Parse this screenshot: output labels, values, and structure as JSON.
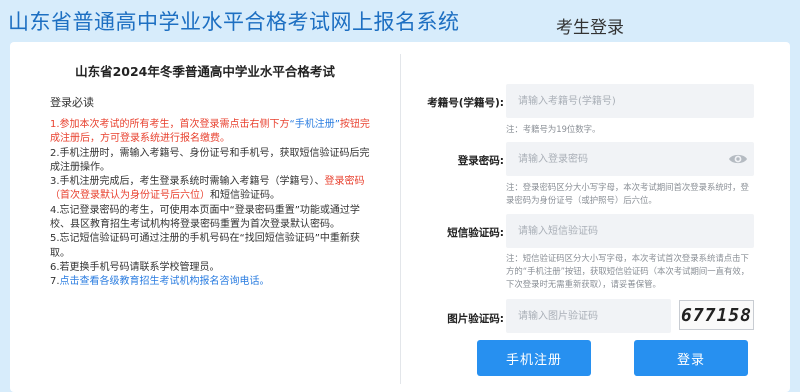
{
  "site_title": "山东省普通高中学业水平合格考试网上报名系统",
  "left": {
    "exam_title": "山东省2024年冬季普通高中学业水平合格考试",
    "notice_heading": "登录必读",
    "item1_red_a": "1.参加本次考试的所有考生，首次登录需点击右侧下方",
    "item1_blue": "“手机注册”",
    "item1_red_b": "按钮完成注册后，方可登录系统进行报名缴费。",
    "item2": "2.手机注册时，需输入考籍号、身份证号和手机号，获取短信验证码后完成注册操作。",
    "item3_a": "3.手机注册完成后，考生登录系统时需输入考籍号（学籍号）、",
    "item3_red": "登录密码（首次登录默认为身份证号后六位）",
    "item3_b": "和短信验证码。",
    "item4": "4.忘记登录密码的考生，可使用本页面中“登录密码重置”功能或通过学校、县区教育招生考试机构将登录密码重置为首次登录默认密码。",
    "item5": "5.忘记短信验证码可通过注册的手机号码在“找回短信验证码”中重新获取。",
    "item6": "6.若更换手机号码请联系学校管理员。",
    "item7_prefix": "7.",
    "item7_blue": "点击查看各级教育招生考试机构报名咨询电话。"
  },
  "login": {
    "title": "考生登录",
    "exam_no_label": "考籍号(学籍号):",
    "exam_no_placeholder": "请输入考籍号(学籍号)",
    "exam_no_note": "注：考籍号为19位数字。",
    "password_label": "登录密码:",
    "password_placeholder": "请输入登录密码",
    "password_note": "注：登录密码区分大小写字母，本次考试期间首次登录系统时，登录密码为身份证号（或护照号）后六位。",
    "sms_label": "短信验证码:",
    "sms_placeholder": "请输入短信验证码",
    "sms_note": "注：短信验证码区分大小写字母，本次考试首次登录系统请点击下方的“手机注册”按钮，获取短信验证码（本次考试期间一直有效，下次登录时无需重新获取），请妥善保管。",
    "captcha_label": "图片验证码:",
    "captcha_placeholder": "请输入图片验证码",
    "captcha_text": "677158",
    "register_button": "手机注册",
    "login_button": "登录"
  },
  "colors": {
    "accent": "#2790f0",
    "title": "#1d6fc2",
    "warning": "#e8412f",
    "link": "#2b7de0",
    "background": "#d7ecfb"
  },
  "icons": {
    "password_toggle": "eye-icon"
  }
}
